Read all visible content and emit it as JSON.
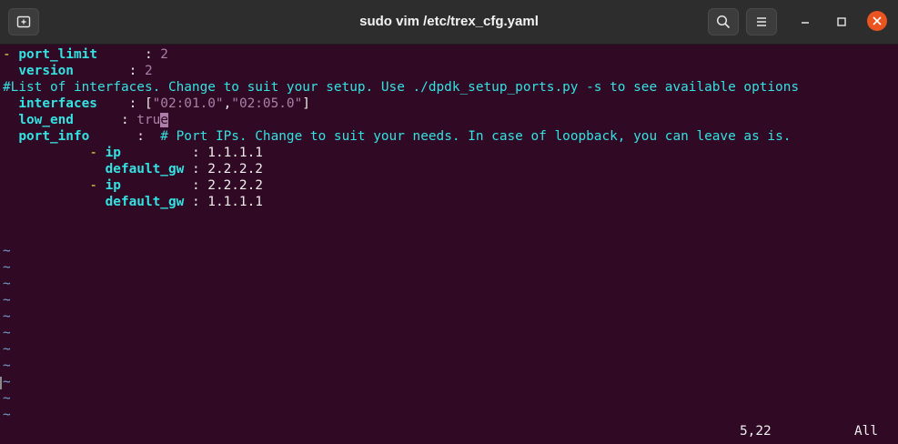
{
  "window": {
    "title": "sudo vim /etc/trex_cfg.yaml",
    "accent": "#e95420"
  },
  "editor": {
    "lines": {
      "l1": {
        "dash": "-",
        "key": "port_limit",
        "sep": "      : ",
        "val": "2"
      },
      "l2": {
        "key": "version",
        "sep": "       : ",
        "val": "2"
      },
      "l3": {
        "comment": "#List of interfaces. Change to suit your setup. Use ./dpdk_setup_ports.py -s to see available options"
      },
      "l4": {
        "key": "interfaces",
        "sep": "    : ",
        "open": "[",
        "q1": "\"02:01.0\"",
        "comma": ",",
        "q2": "\"02:05.0\"",
        "close": "]"
      },
      "l5": {
        "key": "low_end",
        "sep": "      : ",
        "val_before": "tru",
        "val_cursor": "e"
      },
      "l6": {
        "key": "port_info",
        "sep": "      :  ",
        "comment": "# Port IPs. Change to suit your needs. In case of loopback, you can leave as is."
      },
      "l7": {
        "dash": "- ",
        "key": "ip",
        "sep": "         : ",
        "val": "1.1.1.1"
      },
      "l8": {
        "key": "default_gw",
        "sep": " : ",
        "val": "2.2.2.2"
      },
      "l9": {
        "dash": "- ",
        "key": "ip",
        "sep": "         : ",
        "val": "2.2.2.2"
      },
      "l10": {
        "key": "default_gw",
        "sep": " : ",
        "val": "1.1.1.1"
      }
    },
    "tilde": "~",
    "tilde_count": 11
  },
  "status": {
    "position": "5,22",
    "scroll": "All"
  }
}
